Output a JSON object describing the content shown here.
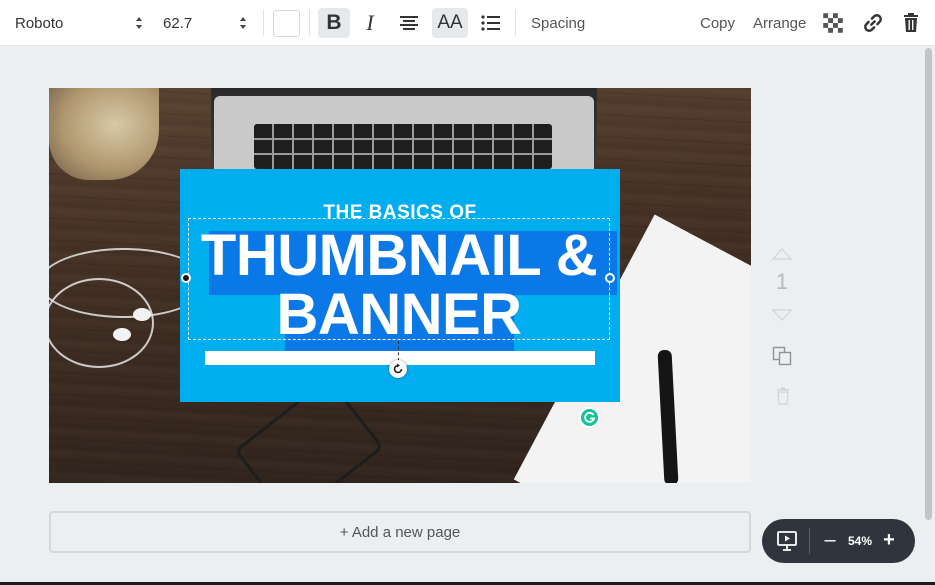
{
  "toolbar": {
    "font_family": "Roboto",
    "font_size": "62.7",
    "bold_label": "B",
    "italic_label": "I",
    "case_label": "AA",
    "spacing_label": "Spacing",
    "copy_label": "Copy",
    "arrange_label": "Arrange",
    "icons": [
      "updown-icon",
      "text-color-swatch",
      "align-center-icon",
      "list-icon",
      "transparency-icon",
      "link-icon",
      "trash-icon"
    ]
  },
  "design": {
    "subtitle": "THE BASICS OF",
    "headline_line1": "THUMBNAIL &",
    "headline_line2": "BANNER"
  },
  "page_controls": {
    "page_number": "1"
  },
  "add_page_label": "+ Add a new page",
  "zoom": {
    "minus_label": "–",
    "value": "54%",
    "plus_label": "+"
  },
  "colors": {
    "card_blue": "#00adef",
    "selection_highlight": "#0b78e8",
    "toolbar_bg": "#ffffff",
    "workspace_bg": "#eceff1",
    "zoom_pill_bg": "#30353d",
    "grammarly_green": "#15c39a"
  }
}
